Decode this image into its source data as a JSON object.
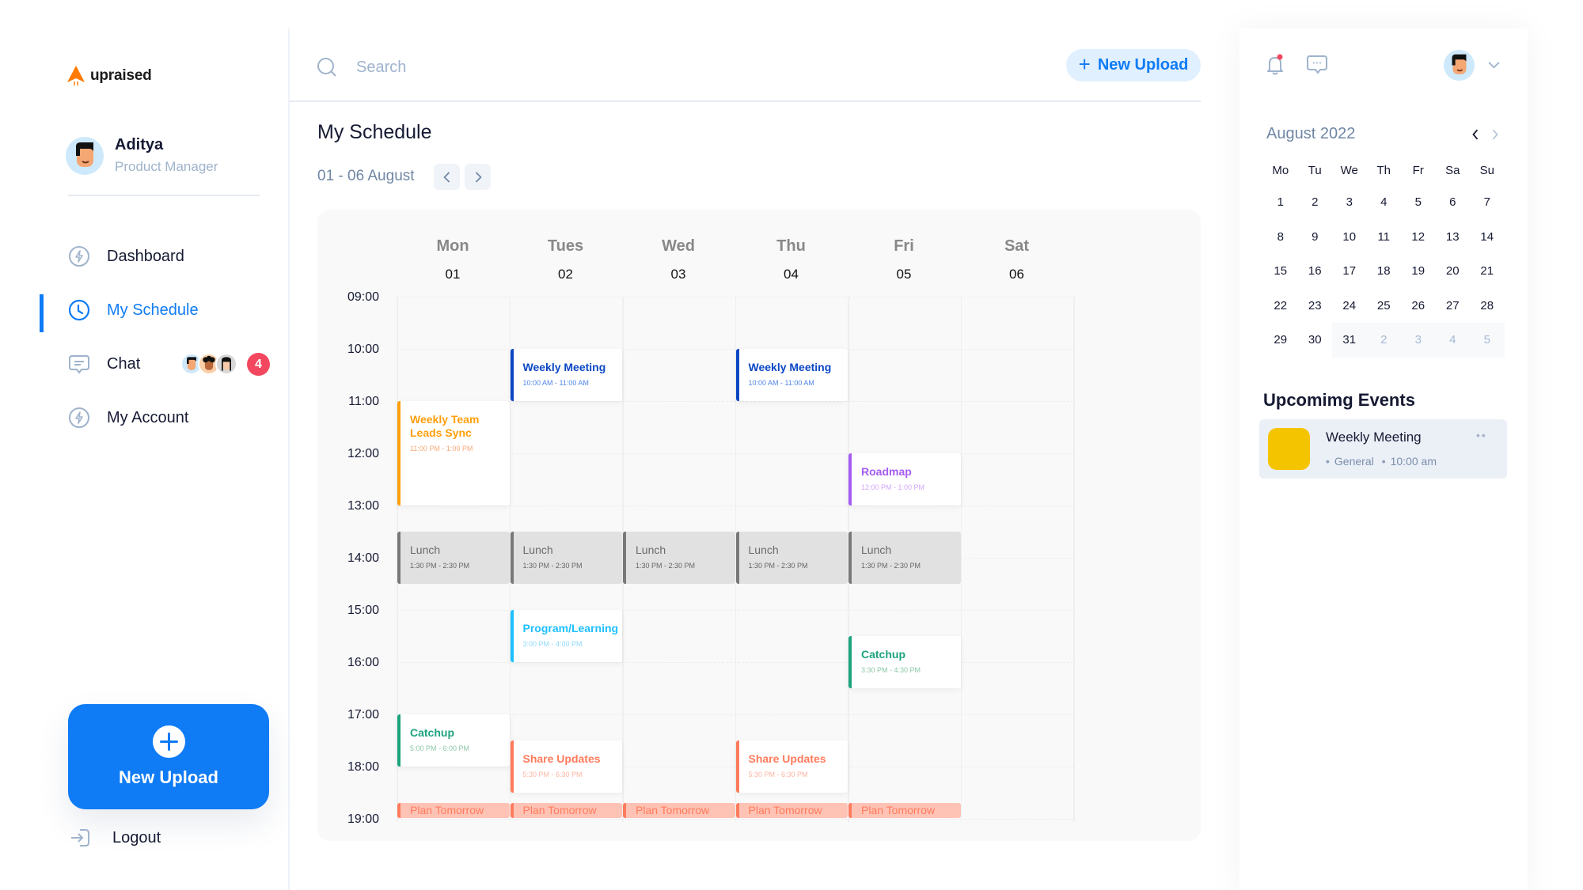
{
  "brand": {
    "name": "upraised",
    "color": "#ff7a00"
  },
  "user": {
    "name": "Aditya",
    "role": "Product Manager"
  },
  "sidebar": {
    "items": [
      {
        "label": "Dashboard",
        "icon": "bolt-circle-icon",
        "active": false
      },
      {
        "label": "My Schedule",
        "icon": "clock-icon",
        "active": true
      },
      {
        "label": "Chat",
        "icon": "chat-bubble-icon",
        "active": false,
        "badge": "4"
      },
      {
        "label": "My Account",
        "icon": "bolt-circle-icon",
        "active": false
      }
    ],
    "upload_label": "New Upload",
    "logout_label": "Logout"
  },
  "header": {
    "search_placeholder": "Search",
    "search_value": "",
    "upload_label": "New Upload"
  },
  "main": {
    "title": "My Schedule",
    "week_range": "01 - 06 August",
    "days": [
      {
        "name": "Mon",
        "num": "01"
      },
      {
        "name": "Tues",
        "num": "02"
      },
      {
        "name": "Wed",
        "num": "03"
      },
      {
        "name": "Thu",
        "num": "04"
      },
      {
        "name": "Fri",
        "num": "05"
      },
      {
        "name": "Sat",
        "num": "06"
      }
    ],
    "times": [
      "09:00",
      "10:00",
      "11:00",
      "12:00",
      "13:00",
      "14:00",
      "15:00",
      "16:00",
      "17:00",
      "18:00",
      "19:00"
    ],
    "events": [
      {
        "day": 0,
        "start": 11,
        "end": 13,
        "title": "Weekly Team Leads Sync",
        "time": "11:00 PM - 1:00 PM",
        "color": "#ff9f0a",
        "time_color": "#f8a978",
        "kind": "card"
      },
      {
        "day": 1,
        "start": 10,
        "end": 11,
        "title": "Weekly Meeting",
        "time": "10:00 AM - 11:00 AM",
        "color": "#0b47c4",
        "time_color": "#4f86e8",
        "kind": "card"
      },
      {
        "day": 3,
        "start": 10,
        "end": 11,
        "title": "Weekly Meeting",
        "time": "10:00 AM - 11:00 AM",
        "color": "#0b47c4",
        "time_color": "#4f86e8",
        "kind": "card"
      },
      {
        "day": 4,
        "start": 12,
        "end": 13,
        "title": "Roadmap",
        "time": "12:00 PM - 1:00 PM",
        "color": "#a55cf2",
        "time_color": "#d2a8f7",
        "kind": "card"
      },
      {
        "day": 0,
        "start": 13.5,
        "end": 14.5,
        "title": "Lunch",
        "time": "1:30 PM - 2:30 PM",
        "color": "#787878",
        "time_color": "#666666",
        "kind": "lunch"
      },
      {
        "day": 1,
        "start": 13.5,
        "end": 14.5,
        "title": "Lunch",
        "time": "1:30 PM - 2:30 PM",
        "color": "#787878",
        "time_color": "#666666",
        "kind": "lunch"
      },
      {
        "day": 2,
        "start": 13.5,
        "end": 14.5,
        "title": "Lunch",
        "time": "1:30 PM - 2:30 PM",
        "color": "#787878",
        "time_color": "#666666",
        "kind": "lunch"
      },
      {
        "day": 3,
        "start": 13.5,
        "end": 14.5,
        "title": "Lunch",
        "time": "1:30 PM - 2:30 PM",
        "color": "#787878",
        "time_color": "#666666",
        "kind": "lunch"
      },
      {
        "day": 4,
        "start": 13.5,
        "end": 14.5,
        "title": "Lunch",
        "time": "1:30 PM - 2:30 PM",
        "color": "#787878",
        "time_color": "#666666",
        "kind": "lunch"
      },
      {
        "day": 1,
        "start": 15,
        "end": 16,
        "title": "Program/Learning",
        "time": "3:00 PM - 4:00 PM",
        "color": "#1ec0ff",
        "time_color": "#8fd9fb",
        "kind": "card"
      },
      {
        "day": 4,
        "start": 15.5,
        "end": 16.5,
        "title": "Catchup",
        "time": "3:30 PM - 4:30 PM",
        "color": "#1ca37e",
        "time_color": "#8cc7a6",
        "kind": "card"
      },
      {
        "day": 0,
        "start": 17,
        "end": 18,
        "title": "Catchup",
        "time": "5:00 PM - 6:00 PM",
        "color": "#1ca37e",
        "time_color": "#8cc7a6",
        "kind": "card"
      },
      {
        "day": 1,
        "start": 17.5,
        "end": 18.5,
        "title": "Share Updates",
        "time": "5:30 PM - 6:30 PM",
        "color": "#ff7b5c",
        "time_color": "#ffb5a2",
        "kind": "card"
      },
      {
        "day": 3,
        "start": 17.5,
        "end": 18.5,
        "title": "Share Updates",
        "time": "5:30 PM - 6:30 PM",
        "color": "#ff7b5c",
        "time_color": "#ffb5a2",
        "kind": "card"
      },
      {
        "day": 0,
        "start": 18.7,
        "end": 19,
        "title": "Plan Tomorrow",
        "time": "",
        "color": "#ff7b5c",
        "time_color": "#ff7b5c",
        "kind": "bar"
      },
      {
        "day": 1,
        "start": 18.7,
        "end": 19,
        "title": "Plan Tomorrow",
        "time": "",
        "color": "#ff7b5c",
        "time_color": "#ff7b5c",
        "kind": "bar"
      },
      {
        "day": 2,
        "start": 18.7,
        "end": 19,
        "title": "Plan Tomorrow",
        "time": "",
        "color": "#ff7b5c",
        "time_color": "#ff7b5c",
        "kind": "bar"
      },
      {
        "day": 3,
        "start": 18.7,
        "end": 19,
        "title": "Plan Tomorrow",
        "time": "",
        "color": "#ff7b5c",
        "time_color": "#ff7b5c",
        "kind": "bar"
      },
      {
        "day": 4,
        "start": 18.7,
        "end": 19,
        "title": "Plan Tomorrow",
        "time": "",
        "color": "#ff7b5c",
        "time_color": "#ff7b5c",
        "kind": "bar"
      }
    ]
  },
  "right_panel": {
    "notifications_unread": true,
    "month_title": "August 2022",
    "weekdays": [
      "Mo",
      "Tu",
      "We",
      "Th",
      "Fr",
      "Sa",
      "Su"
    ],
    "weeks": [
      [
        {
          "d": "1"
        },
        {
          "d": "2"
        },
        {
          "d": "3"
        },
        {
          "d": "4"
        },
        {
          "d": "5"
        },
        {
          "d": "6"
        },
        {
          "d": "7"
        }
      ],
      [
        {
          "d": "8"
        },
        {
          "d": "9"
        },
        {
          "d": "10"
        },
        {
          "d": "11"
        },
        {
          "d": "12"
        },
        {
          "d": "13"
        },
        {
          "d": "14"
        }
      ],
      [
        {
          "d": "15"
        },
        {
          "d": "16"
        },
        {
          "d": "17"
        },
        {
          "d": "18"
        },
        {
          "d": "19"
        },
        {
          "d": "20"
        },
        {
          "d": "21"
        }
      ],
      [
        {
          "d": "22"
        },
        {
          "d": "23"
        },
        {
          "d": "24"
        },
        {
          "d": "25"
        },
        {
          "d": "26"
        },
        {
          "d": "27"
        },
        {
          "d": "28"
        }
      ],
      [
        {
          "d": "29"
        },
        {
          "d": "30"
        },
        {
          "d": "31",
          "shaded": true
        },
        {
          "d": "2",
          "other": true
        },
        {
          "d": "3",
          "other": true
        },
        {
          "d": "4",
          "other": true
        },
        {
          "d": "5",
          "other": true
        }
      ]
    ],
    "upcoming_title": "Upcomimg Events",
    "upcoming": [
      {
        "name": "Weekly Meeting",
        "category": "General",
        "time": "10:00 am",
        "color": "#f5c400"
      }
    ]
  }
}
